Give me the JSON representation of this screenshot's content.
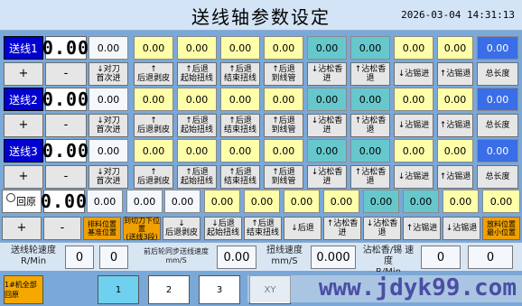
{
  "header": {
    "title": "送线轴参数设定",
    "datetime": "2026-03-04  14:31:13"
  },
  "lines": [
    {
      "label": "送线1",
      "display": "0.00",
      "values": [
        "0.00",
        "0.00",
        "0.00",
        "0.00",
        "0.00",
        "0.00",
        "0.00",
        "0.00",
        "0.00",
        "0.00"
      ],
      "buttons": [
        [
          "↓对刀",
          "首次进"
        ],
        [
          "↑",
          "后退剥皮"
        ],
        [
          "↑后退",
          "起始扭线"
        ],
        [
          "↑后退",
          "结束扭线"
        ],
        [
          "↑后退",
          "到线管"
        ],
        [
          "↓沾松香进",
          ""
        ],
        [
          "↑沾松香退",
          ""
        ],
        [
          "↓沾锡进",
          ""
        ],
        [
          "↑沾锡退",
          ""
        ],
        [
          "总长度",
          ""
        ]
      ]
    },
    {
      "label": "送线2",
      "display": "0.00",
      "values": [
        "0.00",
        "0.00",
        "0.00",
        "0.00",
        "0.00",
        "0.00",
        "0.00",
        "0.00",
        "0.00",
        "0.00"
      ],
      "buttons": [
        [
          "↓对刀",
          "首次进"
        ],
        [
          "↑",
          "后退剥皮"
        ],
        [
          "↑后退",
          "起始扭线"
        ],
        [
          "↑后退",
          "结束扭线"
        ],
        [
          "↑后退",
          "到线管"
        ],
        [
          "↓沾松香进",
          ""
        ],
        [
          "↑沾松香退",
          ""
        ],
        [
          "↓沾锡进",
          ""
        ],
        [
          "↑沾锡退",
          ""
        ],
        [
          "总长度",
          ""
        ]
      ]
    },
    {
      "label": "送线3",
      "display": "0.00",
      "values": [
        "0.00",
        "0.00",
        "0.00",
        "0.00",
        "0.00",
        "0.00",
        "0.00",
        "0.00",
        "0.00",
        "0.00"
      ],
      "buttons": [
        [
          "↓对刀",
          "首次进"
        ],
        [
          "↑",
          "后退剥皮"
        ],
        [
          "↑后退",
          "起始扭线"
        ],
        [
          "↑后退",
          "结束扭线"
        ],
        [
          "↑后退",
          "到线管"
        ],
        [
          "↓沾松香进",
          ""
        ],
        [
          "↑沾松香退",
          ""
        ],
        [
          "↓沾锡进",
          ""
        ],
        [
          "↑沾锡退",
          ""
        ],
        [
          "总长度",
          ""
        ]
      ]
    }
  ],
  "plus": "+",
  "minus": "-",
  "reset": {
    "label": "回原",
    "display": "0.00",
    "values": [
      "0.00",
      "0.00",
      "0.00",
      "0.00",
      "0.00",
      "0.00",
      "0.00",
      "0.00",
      "0.00",
      "0.00",
      "0.00",
      "0.00"
    ],
    "buttons": [
      [
        "排料位置",
        "基准位置"
      ],
      [
        "到切刀下位置",
        "(送线3段)"
      ],
      [
        "↓",
        "后退剥皮"
      ],
      [
        "↓后退",
        "起始扭线"
      ],
      [
        "↑后退",
        "结束扭线"
      ],
      [
        "↓后退",
        ""
      ],
      [
        "↑沾松香进",
        ""
      ],
      [
        "↓沾松香退",
        ""
      ],
      [
        "↑沾锡进",
        ""
      ],
      [
        "↓沾锡退",
        ""
      ],
      [
        "放料位置",
        "最小位置"
      ]
    ]
  },
  "speed": {
    "feed_label1": "送线轮速度",
    "feed_label2": "R/Min",
    "feed_v1": "0",
    "feed_v2": "0",
    "sync_label1": "前后轮同步送线速度",
    "sync_label2": "mm/S",
    "sync_v": "0.00",
    "twist_label1": "扭线速度",
    "twist_label2": "mm/S",
    "twist_v": "0.000",
    "dip_label1": "沾松香/锡 速度",
    "dip_label2": "R/Min",
    "dip_v1": "0",
    "dip_v2": "0"
  },
  "bottom": {
    "all_reset": "1#机全部回原",
    "pages": [
      "1",
      "2",
      "3",
      "XY"
    ],
    "watermark": "www.jdyk99.com"
  }
}
